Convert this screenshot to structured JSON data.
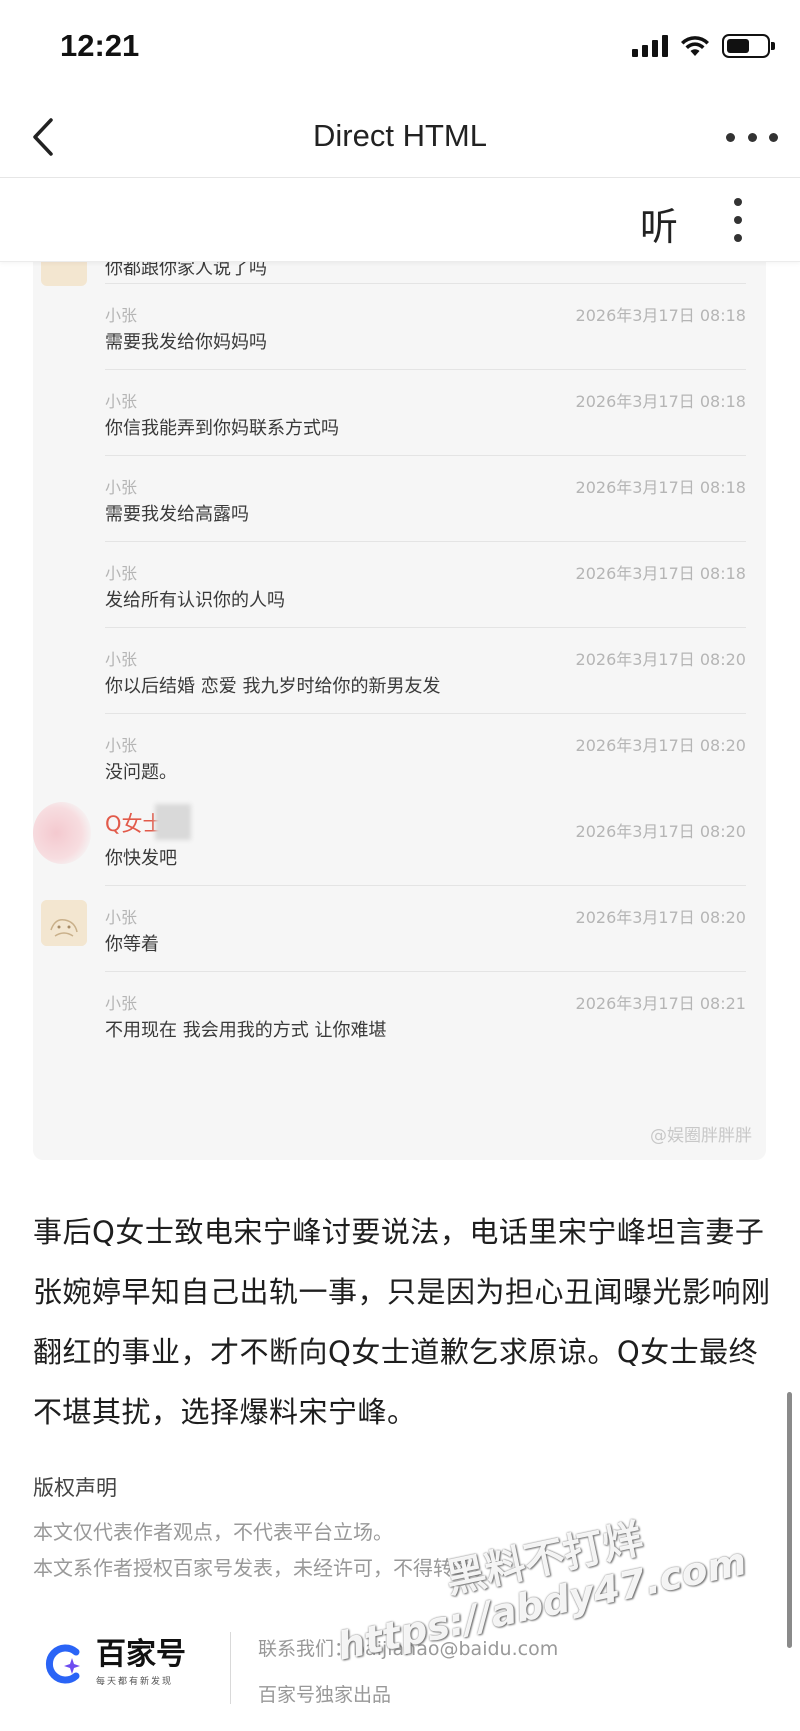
{
  "status_bar": {
    "time": "12:21"
  },
  "nav": {
    "title": "Direct HTML"
  },
  "toolbar": {
    "listen_label": "听"
  },
  "chat": {
    "first_text": "你都跟你家人说了吗",
    "messages": [
      {
        "sender": "小张",
        "time": "2026年3月17日 08:18",
        "text": "需要我发给你妈妈吗"
      },
      {
        "sender": "小张",
        "time": "2026年3月17日 08:18",
        "text": "你信我能弄到你妈联系方式吗"
      },
      {
        "sender": "小张",
        "time": "2026年3月17日 08:18",
        "text": "需要我发给高露吗"
      },
      {
        "sender": "小张",
        "time": "2026年3月17日 08:18",
        "text": "发给所有认识你的人吗"
      },
      {
        "sender": "小张",
        "time": "2026年3月17日 08:20",
        "text": "你以后结婚 恋爱 我九岁时给你的新男友发"
      },
      {
        "sender": "小张",
        "time": "2026年3月17日 08:20",
        "text": "没问题。"
      },
      {
        "sender": "Q女士",
        "time": "2026年3月17日 08:20",
        "text": "你快发吧"
      },
      {
        "sender": "小张",
        "time": "2026年3月17日 08:20",
        "text": "你等着"
      },
      {
        "sender": "小张",
        "time": "2026年3月17日 08:21",
        "text": "不用现在 我会用我的方式 让你难堪"
      }
    ],
    "watermark": "@娱圈胖胖胖"
  },
  "article": {
    "paragraph": "事后Q女士致电宋宁峰讨要说法，电话里宋宁峰坦言妻子张婉婷早知自己出轨一事，只是因为担心丑闻曝光影响刚翻红的事业，才不断向Q女士道歉乞求原谅。Q女士最终不堪其扰，选择爆料宋宁峰。",
    "copyright_title": "版权声明",
    "copyright_line1": "本文仅代表作者观点，不代表平台立场。",
    "copyright_line2": "本文系作者授权百家号发表，未经许可，不得转载。"
  },
  "footer": {
    "logo_name": "百家号",
    "logo_slogan": "每天都有新发现",
    "contact": "联系我们：baijiahao@baidu.com",
    "exclusive": "百家号独家出品"
  },
  "overlay_watermark": {
    "line1": "黑料不打烊",
    "line2": "https://abdy47.com"
  },
  "colors": {
    "accent_blue": "#2a64f6",
    "sender_red": "#e25a4a"
  }
}
